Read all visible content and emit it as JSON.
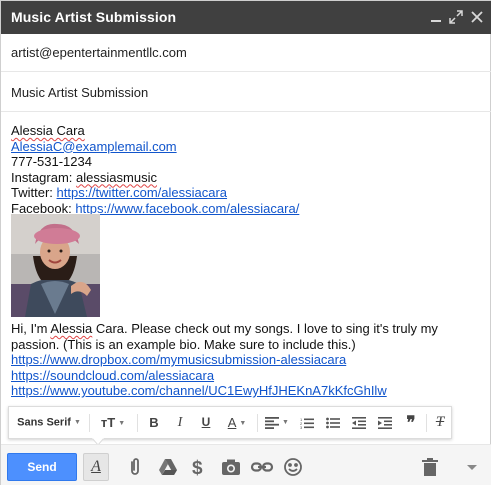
{
  "window": {
    "title": "Music Artist Submission",
    "controls": {
      "minimize": "minus-icon",
      "popout": "expand-icon",
      "close": "close-icon"
    }
  },
  "compose": {
    "to": "artist@epentertainmentllc.com",
    "subject": "Music Artist Submission"
  },
  "signature": {
    "name": "Alessia Cara",
    "email": "AlessiaC@examplemail.com",
    "phone": "777-531-1234",
    "instagram_label": "Instagram:",
    "instagram_handle": "alessiasmusic",
    "twitter_label": "Twitter:",
    "twitter_url": "https://twitter.com/alessiacara",
    "facebook_label": "Facebook:",
    "facebook_url": "https://www.facebook.com/alessiacara/"
  },
  "bio": {
    "pre": "Hi, I'm ",
    "name": "Alessia",
    "post": " Cara. Please check out my songs. I love to sing it's truly my passion. (This is an example bio. Make sure to include this.)",
    "links": [
      "https://www.dropbox.com/mymusicsubmission-alessiacara",
      "https://soundcloud.com/alessiacara",
      "https://www.youtube.com/channel/UC1EwyHfJHEKnA7kKfcGhIlw"
    ]
  },
  "format_toolbar": {
    "font": "Sans Serif",
    "size_icon": "text-size-icon",
    "bold": "B",
    "italic": "I",
    "underline": "U",
    "text_color": "A",
    "align_icon": "align-left-icon",
    "numbered_icon": "numbered-list-icon",
    "bulleted_icon": "bulleted-list-icon",
    "indent_less_icon": "indent-less-icon",
    "indent_more_icon": "indent-more-icon",
    "quote": "❞",
    "clear_format": "T"
  },
  "bottom_bar": {
    "send_label": "Send",
    "formatting_toggle": "A",
    "icons": [
      "paperclip-icon",
      "drive-icon",
      "dollar-icon",
      "camera-icon",
      "link-icon",
      "emoji-icon",
      "trash-icon",
      "more-options-icon"
    ],
    "send_color": "#4d90fe"
  },
  "colors": {
    "titlebar": "#404040",
    "link": "#1155cc"
  }
}
